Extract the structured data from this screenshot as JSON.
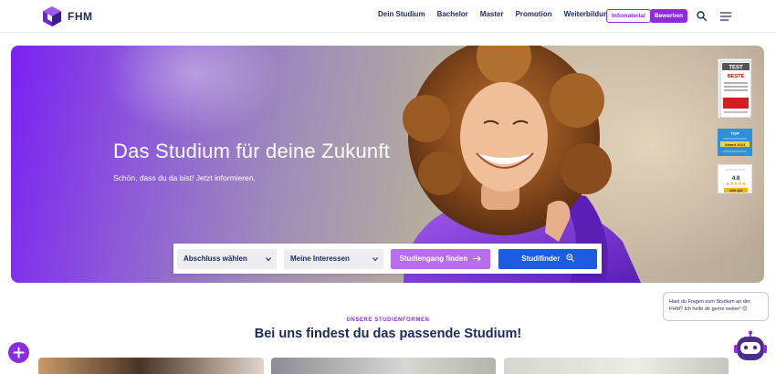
{
  "header": {
    "logo_text": "FHM",
    "nav": [
      "Dein Studium",
      "Bachelor",
      "Master",
      "Promotion",
      "Weiterbildung"
    ],
    "info_button": "Infomaterial",
    "apply_button": "Bewerben",
    "brand_color": "#8b2be2",
    "navy_color": "#1b2a5a"
  },
  "hero": {
    "title": "Das Studium für deine Zukunft",
    "subtitle": "Schön, dass du da bist! Jetzt informieren.",
    "badges": {
      "b1_top": "TEST",
      "b1_title": "BESTE",
      "b2_title": "TOP",
      "b2_year": "Award 2024",
      "b3_score": "4.8",
      "b3_label": "sehr gut"
    }
  },
  "finder": {
    "degree_select": "Abschluss wählen",
    "interest_select": "Meine Interessen",
    "find_button": "Studiengang finden",
    "studifinder_button": "Studifinder",
    "finder_blue": "#1d5be0",
    "find_purple": "#b86df0"
  },
  "section": {
    "eyebrow": "UNSERE STUDIENFORMEN",
    "title": "Bei uns findest du das passende Studium!"
  },
  "chat": {
    "line1": "Hast du Fragen zum Studium an der",
    "line2": "FHM? Ich helfe dir gerne weiter! 😊"
  },
  "icons": [
    "logo-icon",
    "search-icon",
    "menu-icon",
    "chevron-down-icon",
    "arrow-right-icon",
    "magnifier-icon",
    "plus-icon",
    "chatbot-icon"
  ]
}
